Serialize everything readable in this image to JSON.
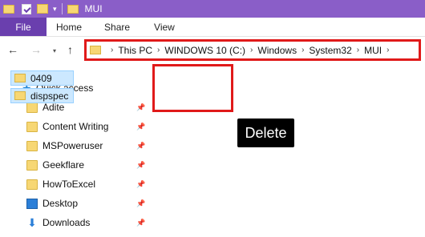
{
  "window": {
    "title": "MUI"
  },
  "quick_access_toolbar": {
    "dropdown_glyph": "▾"
  },
  "ribbon": {
    "tabs": [
      "File",
      "Home",
      "Share",
      "View"
    ]
  },
  "navigation": {
    "back_glyph": "←",
    "forward_glyph": "→",
    "recent_glyph": "▾",
    "up_glyph": "↑"
  },
  "address_bar": {
    "breadcrumbs": [
      "This PC",
      "WINDOWS 10 (C:)",
      "Windows",
      "System32",
      "MUI"
    ],
    "separator": "›"
  },
  "sidebar": {
    "items": [
      {
        "label": "Quick access",
        "icon": "star-icon",
        "pinned": false
      },
      {
        "label": "Adite",
        "icon": "folder-icon",
        "pinned": true
      },
      {
        "label": "Content Writing",
        "icon": "folder-icon",
        "pinned": true
      },
      {
        "label": "MSPoweruser",
        "icon": "folder-icon",
        "pinned": true
      },
      {
        "label": "Geekflare",
        "icon": "folder-icon",
        "pinned": true
      },
      {
        "label": "HowToExcel",
        "icon": "folder-icon",
        "pinned": true
      },
      {
        "label": "Desktop",
        "icon": "desktop-icon",
        "pinned": true
      },
      {
        "label": "Downloads",
        "icon": "download-icon",
        "pinned": true
      }
    ],
    "pin_glyph": "📌",
    "star_glyph": "★",
    "download_glyph": "⬇"
  },
  "content": {
    "files": [
      {
        "name": "0409"
      },
      {
        "name": "dispspec"
      }
    ]
  },
  "annotation": {
    "label": "Delete"
  },
  "colors": {
    "titlebar": "#8a5ec8",
    "file_tab": "#6a3fae",
    "highlight_border": "#e01a1a",
    "selection": "#cce8ff"
  }
}
